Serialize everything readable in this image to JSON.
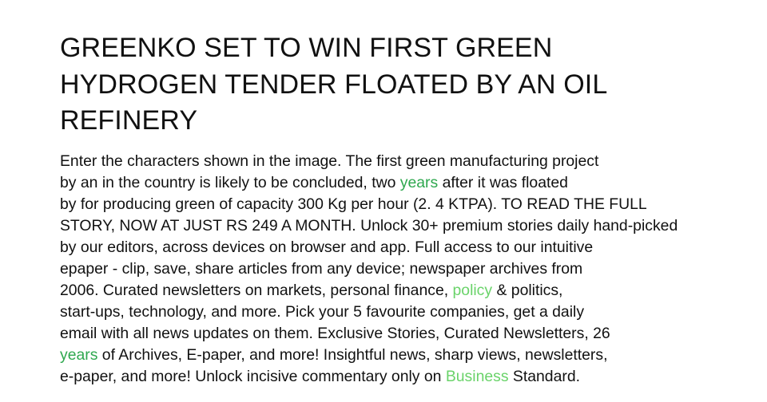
{
  "colors": {
    "text": "#111111",
    "keyword_green_dark": "#2fa84f",
    "keyword_green_light": "#6ad36a",
    "background": "#ffffff"
  },
  "article": {
    "headline_lines": [
      "GREENKO SET TO WIN FIRST GREEN",
      "HYDROGEN TENDER FLOATED BY AN OIL",
      "REFINERY"
    ],
    "body": [
      {
        "segments": [
          {
            "text": "Enter the characters shown in the image. The first green manufacturing project"
          }
        ]
      },
      {
        "segments": [
          {
            "text": "by an in the country is likely to be concluded, two "
          },
          {
            "text": "years",
            "link": true,
            "tone": "dark"
          },
          {
            "text": " after it was floated"
          }
        ]
      },
      {
        "segments": [
          {
            "text": "by for producing green of capacity 300 Kg per hour (2. 4 KTPA). TO READ THE FULL"
          }
        ]
      },
      {
        "segments": [
          {
            "text": "STORY, NOW AT JUST RS 249 A MONTH. Unlock 30+ premium stories daily hand-picked"
          }
        ]
      },
      {
        "segments": [
          {
            "text": "by our editors, across devices on browser and app. Full access to our intuitive"
          }
        ]
      },
      {
        "segments": [
          {
            "text": "epaper - clip, save, share articles from any device; newspaper archives from"
          }
        ]
      },
      {
        "segments": [
          {
            "text": "2006. Curated newsletters on markets, personal finance, "
          },
          {
            "text": "policy",
            "link": true,
            "tone": "light"
          },
          {
            "text": " & politics,"
          }
        ]
      },
      {
        "segments": [
          {
            "text": "start-ups, technology, and more. Pick your 5 favourite companies, get a daily"
          }
        ]
      },
      {
        "segments": [
          {
            "text": "email with all news updates on them. Exclusive Stories, Curated Newsletters, 26"
          }
        ]
      },
      {
        "segments": [
          {
            "text": "years",
            "link": true,
            "tone": "dark"
          },
          {
            "text": " of Archives, E-paper, and more! Insightful news, sharp views, newsletters,"
          }
        ]
      },
      {
        "segments": [
          {
            "text": "e-paper, and more! Unlock incisive commentary only on "
          },
          {
            "text": "Business",
            "link": true,
            "tone": "light"
          },
          {
            "text": " Standard."
          }
        ]
      }
    ]
  }
}
